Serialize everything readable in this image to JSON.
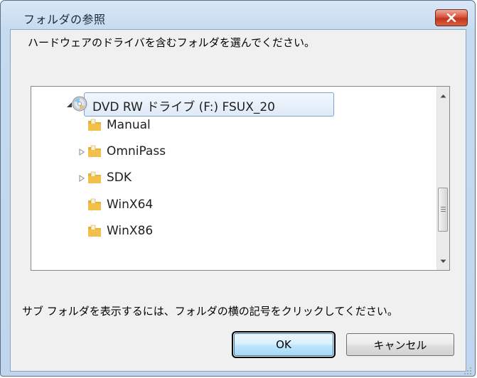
{
  "window": {
    "title": "フォルダの参照",
    "close_icon": "close-x-icon"
  },
  "dialog": {
    "instruction": "ハードウェアのドライバを含むフォルダを選んでください。",
    "hint": "サブ フォルダを表示するには、フォルダの横の記号をクリックしてください。"
  },
  "tree": {
    "root": {
      "label": "DVD RW ドライブ (F:) FSUX_20",
      "icon": "dvd-drive-icon",
      "expanded": true,
      "selected": true
    },
    "children": [
      {
        "label": "Manual",
        "icon": "folder-icon",
        "has_children": false
      },
      {
        "label": "OmniPass",
        "icon": "folder-icon",
        "has_children": true
      },
      {
        "label": "SDK",
        "icon": "folder-icon",
        "has_children": true
      },
      {
        "label": "WinX64",
        "icon": "folder-icon",
        "has_children": false
      },
      {
        "label": "WinX86",
        "icon": "folder-icon",
        "has_children": false
      }
    ]
  },
  "buttons": {
    "ok": "OK",
    "cancel": "キャンセル"
  }
}
